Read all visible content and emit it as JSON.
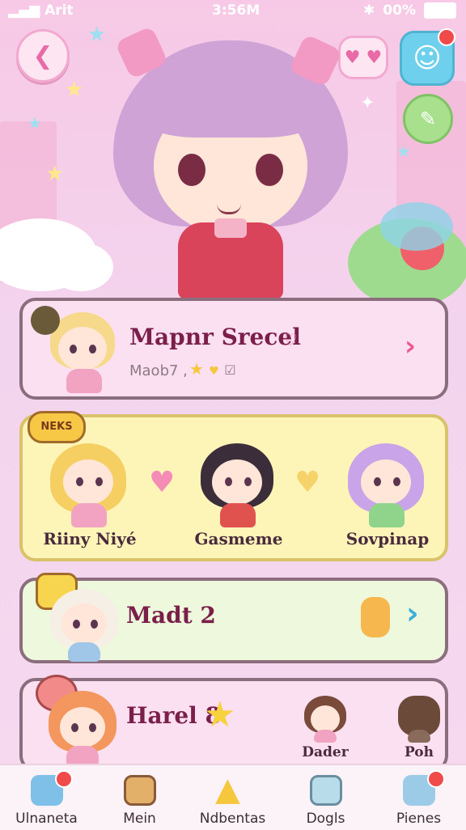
{
  "status_bar": {
    "carrier": "Arit",
    "time": "3:56M",
    "battery": "00%"
  },
  "featured": {
    "title": "Mapnr Srecel",
    "subtitle": "Maob7 ,"
  },
  "team": {
    "badge": "NEKS",
    "members": [
      {
        "name": "Riiny Niyé"
      },
      {
        "name": "Gasmeme"
      },
      {
        "name": "Sovpinap"
      }
    ]
  },
  "row1": {
    "title": "Madt 2"
  },
  "row2": {
    "title": "Harel 8",
    "friends": [
      "Dader",
      "Poh"
    ]
  },
  "nav": [
    {
      "label": "Ulnaneta"
    },
    {
      "label": "Mein"
    },
    {
      "label": "Ndbentas"
    },
    {
      "label": "Dogls"
    },
    {
      "label": "Pienes"
    }
  ],
  "colors": {
    "accent": "#f06fa8",
    "card_yellow": "#fdf5b8",
    "card_green": "#eef8dc",
    "card_pink": "#fbe0f1"
  }
}
